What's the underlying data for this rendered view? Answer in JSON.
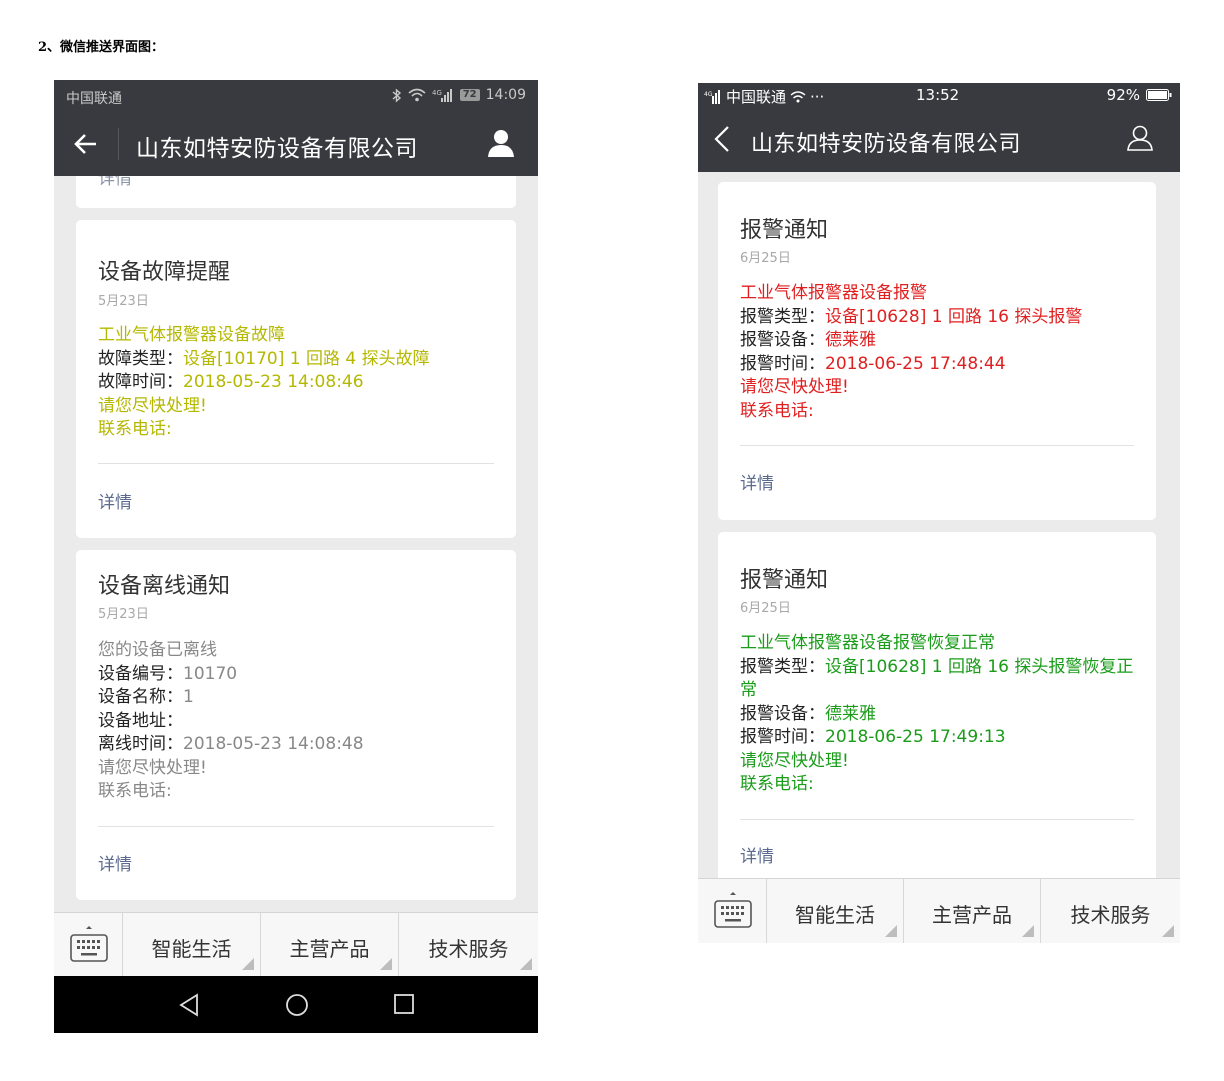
{
  "doc": {
    "heading": "2、微信推送界面图："
  },
  "phoneA": {
    "status": {
      "carrier": "中国联通",
      "battery": "72",
      "time": "14:09"
    },
    "title": "山东如特安防设备有限公司",
    "partial_card": {
      "more": "详情"
    },
    "cards": [
      {
        "title": "设备故障提醒",
        "date": "5月23日",
        "color": "#b5b800",
        "lines": [
          {
            "label": "",
            "value": "工业气体报警器设备故障"
          },
          {
            "label": "故障类型：",
            "value": "设备[10170] 1 回路 4 探头故障"
          },
          {
            "label": "故障时间：",
            "value": "2018-05-23 14:08:46"
          },
          {
            "label": "",
            "value": "请您尽快处理!"
          },
          {
            "label": "",
            "value": "联系电话:"
          }
        ],
        "more": "详情"
      },
      {
        "title": "设备离线通知",
        "date": "5月23日",
        "color": "#888888",
        "lines": [
          {
            "label": "",
            "value": "您的设备已离线"
          },
          {
            "label": "设备编号：",
            "value": "10170"
          },
          {
            "label": "设备名称：",
            "value": "1"
          },
          {
            "label": "设备地址：",
            "value": ""
          },
          {
            "label": "离线时间：",
            "value": "2018-05-23 14:08:48"
          },
          {
            "label": "",
            "value": "请您尽快处理!"
          },
          {
            "label": "",
            "value": "联系电话:"
          }
        ],
        "more": "详情"
      }
    ],
    "menu": [
      "智能生活",
      "主营产品",
      "技术服务"
    ]
  },
  "phoneB": {
    "status": {
      "carrier": "中国联通",
      "dots": "···",
      "time": "13:52",
      "battery": "92%"
    },
    "title": "山东如特安防设备有限公司",
    "cards": [
      {
        "title": "报警通知",
        "date": "6月25日",
        "color": "#e02020",
        "lines": [
          {
            "label": "",
            "value": "工业气体报警器设备报警"
          },
          {
            "label": "报警类型：",
            "value": "设备[10628] 1 回路 16 探头报警"
          },
          {
            "label": "报警设备：",
            "value": "德莱雅"
          },
          {
            "label": "报警时间：",
            "value": "2018-06-25 17:48:44"
          },
          {
            "label": "",
            "value": "请您尽快处理!"
          },
          {
            "label": "",
            "value": "联系电话:"
          }
        ],
        "more": "详情"
      },
      {
        "title": "报警通知",
        "date": "6月25日",
        "color": "#1a9c1a",
        "lines": [
          {
            "label": "",
            "value": "工业气体报警器设备报警恢复正常"
          },
          {
            "label": "报警类型：",
            "value": "设备[10628] 1 回路 16 探头报警恢复正常"
          },
          {
            "label": "报警设备：",
            "value": "德莱雅"
          },
          {
            "label": "报警时间：",
            "value": "2018-06-25 17:49:13"
          },
          {
            "label": "",
            "value": "请您尽快处理!"
          },
          {
            "label": "",
            "value": "联系电话:"
          }
        ],
        "more": "详情"
      }
    ],
    "menu": [
      "智能生活",
      "主营产品",
      "技术服务"
    ]
  }
}
